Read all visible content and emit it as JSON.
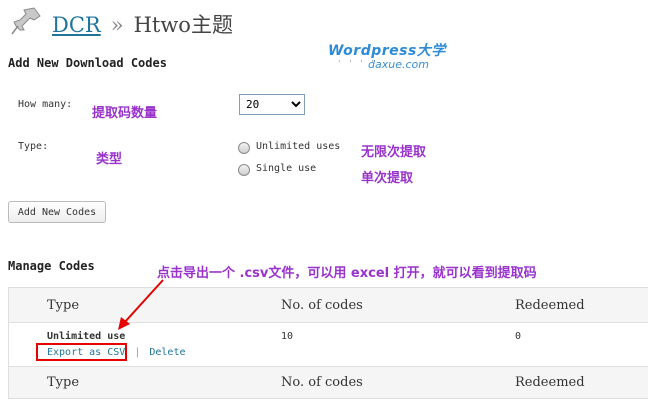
{
  "header": {
    "link": "DCR",
    "separator": "»",
    "title": "Htwo主题"
  },
  "watermark": {
    "top": "Wordpress大学",
    "bottom": "daxue.com"
  },
  "add_section": {
    "heading": "Add New Download Codes",
    "how_many_label": "How many:",
    "how_many_value": "20",
    "type_label": "Type:",
    "radio_unlimited": "Unlimited uses",
    "radio_single": "Single use",
    "button": "Add New Codes"
  },
  "annotations": {
    "how_many_note": "提取码数量",
    "type_note": "类型",
    "unlimited_note": "无限次提取",
    "single_note": "单次提取",
    "export_note": "点击导出一个 .csv文件，可以用 excel 打开，就可以看到提取码"
  },
  "manage_section": {
    "heading": "Manage Codes",
    "columns": [
      "Type",
      "No. of codes",
      "Redeemed"
    ],
    "rows": [
      {
        "type": "Unlimited use",
        "codes": "10",
        "redeemed": "0"
      }
    ],
    "actions": {
      "export": "Export as CSV",
      "separator": "|",
      "delete": "Delete"
    }
  },
  "colors": {
    "accent_purple": "#9933cc",
    "link_blue": "#21759b",
    "highlight_red": "#e60000"
  }
}
